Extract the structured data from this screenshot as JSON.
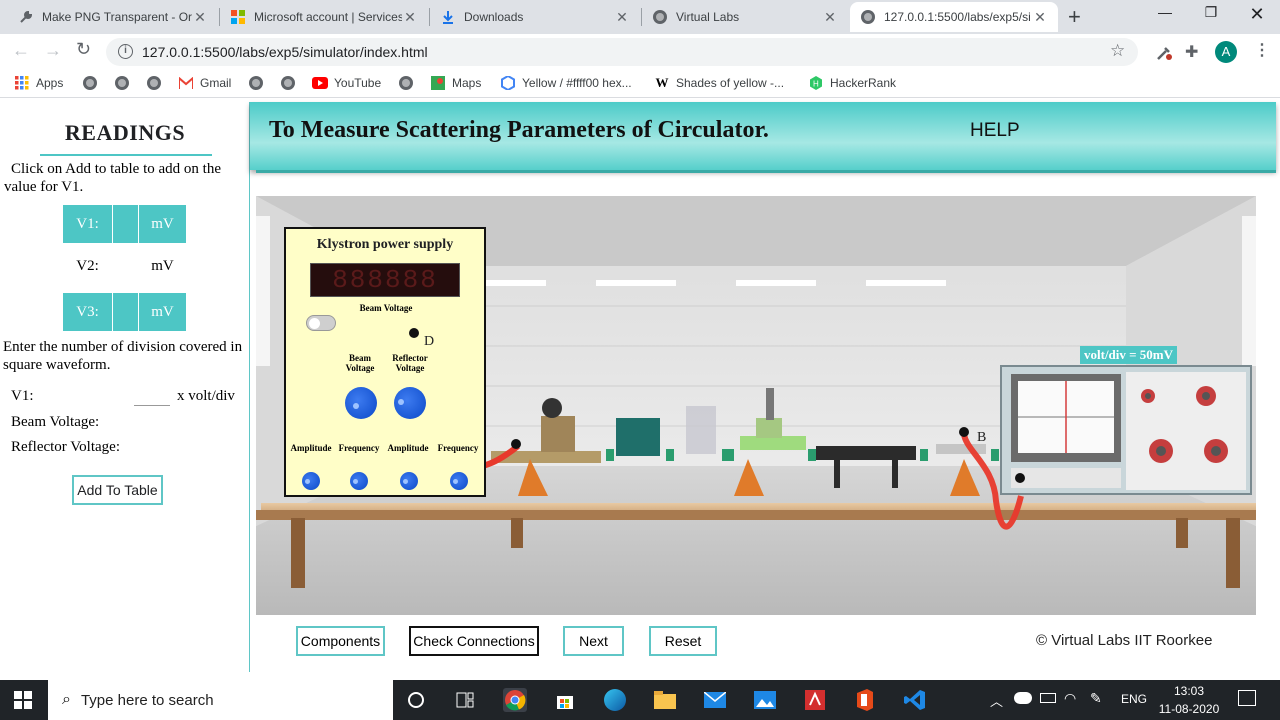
{
  "browser": {
    "tabs": [
      {
        "title": "Make PNG Transparent - Or",
        "icon": "wrench-icon"
      },
      {
        "title": "Microsoft account | Services",
        "icon": "microsoft-icon"
      },
      {
        "title": "Downloads",
        "icon": "download-icon"
      },
      {
        "title": "Virtual Labs",
        "icon": "globe-icon"
      },
      {
        "title": "127.0.0.1:5500/labs/exp5/si",
        "icon": "globe-icon",
        "active": true
      }
    ],
    "url": "127.0.0.1:5500/labs/exp5/simulator/index.html",
    "profile_initial": "A",
    "bookmarks": [
      {
        "label": "Apps",
        "icon": "apps-grid-icon"
      },
      {
        "label": "",
        "icon": "globe-icon"
      },
      {
        "label": "",
        "icon": "globe-icon"
      },
      {
        "label": "",
        "icon": "globe-icon"
      },
      {
        "label": "Gmail",
        "icon": "gmail-icon"
      },
      {
        "label": "",
        "icon": "globe-icon"
      },
      {
        "label": "",
        "icon": "globe-icon"
      },
      {
        "label": "YouTube",
        "icon": "youtube-icon"
      },
      {
        "label": "",
        "icon": "globe-icon"
      },
      {
        "label": "Maps",
        "icon": "maps-icon"
      },
      {
        "label": "Yellow / #ffff00 hex...",
        "icon": "color-hex-icon"
      },
      {
        "label": "Shades of yellow -...",
        "icon": "wikipedia-icon"
      },
      {
        "label": "HackerRank",
        "icon": "hackerrank-icon"
      }
    ]
  },
  "readings": {
    "title": "READINGS",
    "instruction": "Click on Add to table to add on the value for V1.",
    "rows": [
      {
        "label": "V1:",
        "value": "",
        "unit": "mV"
      },
      {
        "label": "V2:",
        "value": "",
        "unit": "mV"
      },
      {
        "label": "V3:",
        "value": "",
        "unit": "mV"
      }
    ],
    "division_instruction": "Enter the number of division covered in square waveform.",
    "v1_label": "V1:",
    "v1_suffix": "x volt/div",
    "beam_voltage_label": "Beam Voltage:",
    "reflector_voltage_label": "Reflector Voltage:",
    "add_button": "Add To Table"
  },
  "header": {
    "title": "To Measure Scattering Parameters of Circulator.",
    "help": "HELP"
  },
  "simulator": {
    "klystron_title": "Klystron power supply",
    "beam_voltage_display_label": "Beam Voltage",
    "knob_labels": [
      "Beam Voltage",
      "Reflector Voltage"
    ],
    "small_knob_labels": [
      "Amplitude",
      "Frequency",
      "Amplitude",
      "Frequency"
    ],
    "point_d": "D",
    "point_b": "B",
    "volt_div": "volt/div = 50mV"
  },
  "controls": {
    "components": "Components",
    "check_connections": "Check Connections",
    "next": "Next",
    "reset": "Reset",
    "copyright": "© Virtual Labs IIT Roorkee"
  },
  "taskbar": {
    "search_placeholder": "Type here to search",
    "language": "ENG",
    "time": "13:03",
    "date": "11-08-2020"
  }
}
